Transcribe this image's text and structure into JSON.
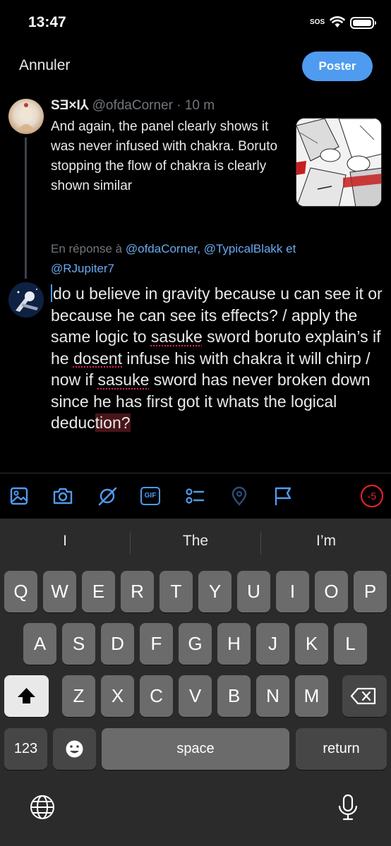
{
  "status_bar": {
    "time": "13:47",
    "sos": "SOS"
  },
  "header": {
    "cancel_label": "Annuler",
    "post_label": "Poster"
  },
  "quoted_tweet": {
    "display_name": "SƎ×I⅄",
    "handle": "@ofdaCorner",
    "separator": " · ",
    "time": "10 m",
    "text": "And again, the panel clearly shows it was never infused with chakra. Boruto stopping the flow of chakra is clearly shown similar"
  },
  "reply_context": {
    "prefix": "En réponse à ",
    "mention1": "@ofdaCorner,",
    "mention2": "@TypicalBlakk",
    "conjunction": " et",
    "mention3": "@RJupiter7"
  },
  "compose": {
    "part1": "do u believe in gravity because u can see it or because he can see its effects? / apply the same logic to ",
    "sasuke_1": "sasuke",
    "part2": " sword boruto explain’s if he ",
    "dosent": "dosent",
    "part3": " infuse his with chakra it will chirp / now if ",
    "sasuke_2": "sasuke",
    "part4": " sword has never broken down since he has first got it whats the logical deduc",
    "highlighted": "tion?"
  },
  "toolbar": {
    "icons": [
      "image-icon",
      "camera-icon",
      "grok-icon",
      "gif-icon",
      "poll-icon",
      "location-icon",
      "flag-icon"
    ],
    "gif_label": "GIF",
    "char_counter": "-5",
    "accent_color": "#4f9bef",
    "warning_color": "#f4212e"
  },
  "keyboard": {
    "suggestions": [
      "I",
      "The",
      "I’m"
    ],
    "row1": [
      "Q",
      "W",
      "E",
      "R",
      "T",
      "Y",
      "U",
      "I",
      "O",
      "P"
    ],
    "row2": [
      "A",
      "S",
      "D",
      "F",
      "G",
      "H",
      "J",
      "K",
      "L"
    ],
    "row3": [
      "Z",
      "X",
      "C",
      "V",
      "B",
      "N",
      "M"
    ],
    "numbers_label": "123",
    "space_label": "space",
    "return_label": "return"
  }
}
